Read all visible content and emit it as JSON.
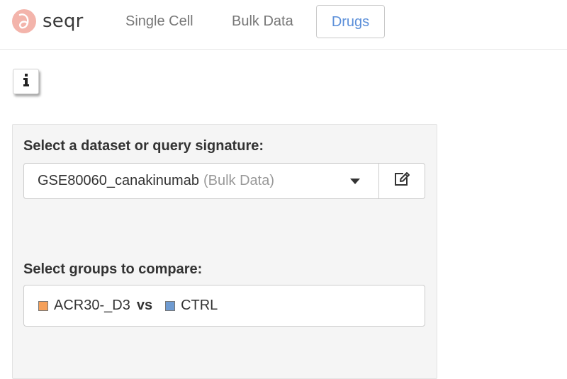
{
  "navbar": {
    "brand": "seqr",
    "items": [
      {
        "label": "Single Cell",
        "active": false
      },
      {
        "label": "Bulk Data",
        "active": false
      },
      {
        "label": "Drugs",
        "active": true
      }
    ]
  },
  "info_button": {
    "icon": "info-icon"
  },
  "dataset": {
    "label": "Select a dataset or query signature:",
    "value": "GSE80060_canakinumab",
    "suffix": "(Bulk Data)",
    "edit_icon": "edit-icon"
  },
  "groups": {
    "label": "Select groups to compare:",
    "group1": "ACR30-_D3",
    "vs": "vs",
    "group2": "CTRL",
    "group1_color": "#f5a05a",
    "group2_color": "#6f9bd1"
  },
  "colors": {
    "brand_logo": "#f3b4ab",
    "active_nav": "#5b8fd9",
    "panel_bg": "#f5f5f5"
  }
}
